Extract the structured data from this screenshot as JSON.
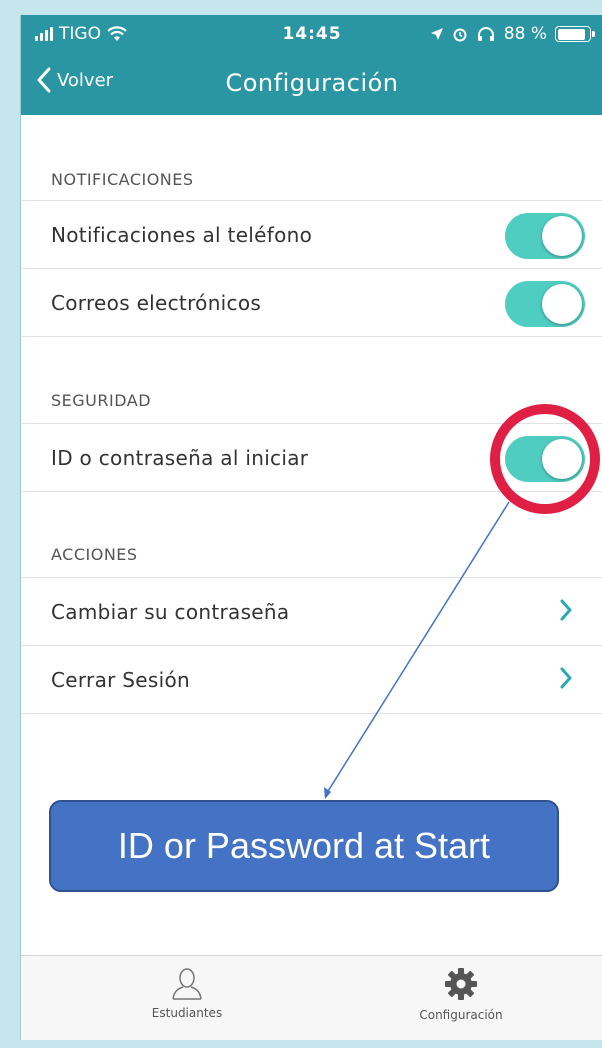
{
  "status_bar": {
    "carrier": "TIGO",
    "time": "14:45",
    "battery": "88 %",
    "battery_level": 0.88
  },
  "nav": {
    "back_label": "Volver",
    "title": "Configuración"
  },
  "sections": {
    "notifications": {
      "header": "NOTIFICACIONES",
      "items": [
        {
          "label": "Notificaciones al teléfono",
          "enabled": true
        },
        {
          "label": "Correos electrónicos",
          "enabled": true
        }
      ]
    },
    "security": {
      "header": "SEGURIDAD",
      "items": [
        {
          "label": "ID o contraseña al iniciar",
          "enabled": true
        }
      ]
    },
    "actions": {
      "header": "ACCIONES",
      "items": [
        {
          "label": "Cambiar su contraseña"
        },
        {
          "label": "Cerrar Sesión"
        }
      ]
    }
  },
  "annotation": {
    "callout_text": "ID or Password at Start"
  },
  "tabbar": {
    "tabs": [
      {
        "label": "Estudiantes",
        "icon": "person-icon"
      },
      {
        "label": "Configuración",
        "icon": "gear-icon"
      }
    ]
  },
  "colors": {
    "header": "#2a96a4",
    "toggle_on": "#4fcdc1",
    "chevron": "#2aa6b6",
    "highlight": "#e01f45",
    "callout": "#4472c4"
  }
}
